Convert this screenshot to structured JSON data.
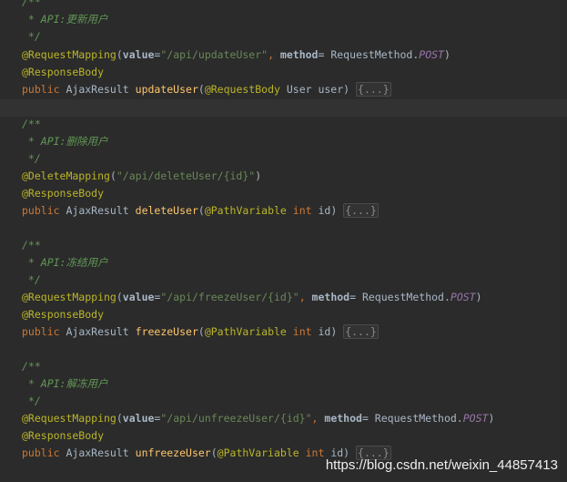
{
  "blocks": [
    {
      "doc_open": "/**",
      "doc_text": " * API:更新用户",
      "doc_close": " */",
      "mapping_ann": "@RequestMapping",
      "mapping_open": "(",
      "value_key": "value",
      "eq": "=",
      "path": "\"/api/updateUser\"",
      "comma": ", ",
      "method_key": "method",
      "method_eq": "= ",
      "method_class": "RequestMethod.",
      "method_const": "POST",
      "mapping_close": ")",
      "body_ann": "@ResponseBody",
      "kw_public": "public",
      "ret_type": " AjaxResult ",
      "fn_name": "updateUser",
      "paren_open": "(",
      "param_ann": "@RequestBody",
      "param_type_kw": "",
      "param_type": " User user",
      "paren_close": ") ",
      "fold": "{...}"
    },
    {
      "doc_open": "/**",
      "doc_text": " * API:删除用户",
      "doc_close": " */",
      "mapping_ann": "@DeleteMapping",
      "mapping_open": "(",
      "path": "\"/api/deleteUser/{id}\"",
      "mapping_close": ")",
      "body_ann": "@ResponseBody",
      "kw_public": "public",
      "ret_type": " AjaxResult ",
      "fn_name": "deleteUser",
      "paren_open": "(",
      "param_ann": "@PathVariable",
      "param_type_kw": " int",
      "param_type": " id",
      "paren_close": ") ",
      "fold": "{...}"
    },
    {
      "doc_open": "/**",
      "doc_text": " * API:冻结用户",
      "doc_close": " */",
      "mapping_ann": "@RequestMapping",
      "mapping_open": "(",
      "value_key": "value",
      "eq": "=",
      "path": "\"/api/freezeUser/{id}\"",
      "comma": ", ",
      "method_key": "method",
      "method_eq": "= ",
      "method_class": "RequestMethod.",
      "method_const": "POST",
      "mapping_close": ")",
      "body_ann": "@ResponseBody",
      "kw_public": "public",
      "ret_type": " AjaxResult ",
      "fn_name": "freezeUser",
      "paren_open": "(",
      "param_ann": "@PathVariable",
      "param_type_kw": " int",
      "param_type": " id",
      "paren_close": ") ",
      "fold": "{...}"
    },
    {
      "doc_open": "/**",
      "doc_text": " * API:解冻用户",
      "doc_close": " */",
      "mapping_ann": "@RequestMapping",
      "mapping_open": "(",
      "value_key": "value",
      "eq": "=",
      "path": "\"/api/unfreezeUser/{id}\"",
      "comma": ", ",
      "method_key": "method",
      "method_eq": "= ",
      "method_class": "RequestMethod.",
      "method_const": "POST",
      "mapping_close": ")",
      "body_ann": "@ResponseBody",
      "kw_public": "public",
      "ret_type": " AjaxResult ",
      "fn_name": "unfreezeUser",
      "paren_open": "(",
      "param_ann": "@PathVariable",
      "param_type_kw": " int",
      "param_type": " id",
      "paren_close": ") ",
      "fold": "{...}"
    }
  ],
  "watermark": "https://blog.csdn.net/weixin_44857413",
  "colors": {
    "background": "#2b2b2b",
    "doc_comment": "#629755",
    "annotation": "#bbb529",
    "string": "#6a8759",
    "keyword": "#cc7832",
    "function": "#ffc66d",
    "constant": "#9876aa"
  }
}
